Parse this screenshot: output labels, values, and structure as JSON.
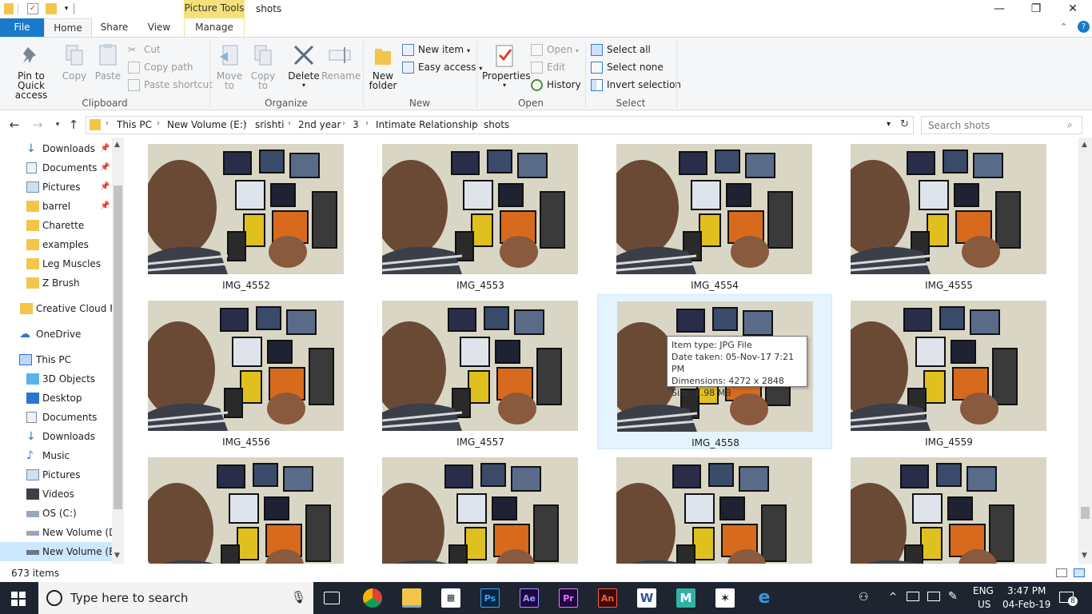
{
  "window": {
    "title": "shots",
    "context_tab": "Picture Tools",
    "controls": {
      "minimize": "—",
      "maximize": "❐",
      "close": "✕"
    }
  },
  "ribbon_tabs": {
    "file": "File",
    "home": "Home",
    "share": "Share",
    "view": "View",
    "manage": "Manage"
  },
  "ribbon": {
    "clipboard": {
      "label": "Clipboard",
      "pin": "Pin to Quick access",
      "pin_l1": "Pin to Quick",
      "pin_l2": "access",
      "copy": "Copy",
      "paste": "Paste",
      "cut": "Cut",
      "copy_path": "Copy path",
      "paste_shortcut": "Paste shortcut"
    },
    "organize": {
      "label": "Organize",
      "move_l1": "Move",
      "move_l2": "to",
      "copy_l1": "Copy",
      "copy_l2": "to",
      "delete": "Delete",
      "rename": "Rename"
    },
    "new": {
      "label": "New",
      "new_folder_l1": "New",
      "new_folder_l2": "folder",
      "new_item": "New item",
      "easy_access": "Easy access"
    },
    "open": {
      "label": "Open",
      "properties": "Properties",
      "open": "Open",
      "edit": "Edit",
      "history": "History"
    },
    "select": {
      "label": "Select",
      "select_all": "Select all",
      "select_none": "Select none",
      "invert": "Invert selection"
    }
  },
  "address": {
    "crumbs": [
      "This PC",
      "New Volume (E:)",
      "srishti",
      "2nd year",
      "3",
      "Intimate Relationship",
      "shots"
    ],
    "search_placeholder": "Search shots"
  },
  "nav": {
    "quick_access": [
      {
        "label": "Downloads",
        "pinned": true
      },
      {
        "label": "Documents",
        "pinned": true
      },
      {
        "label": "Pictures",
        "pinned": true
      },
      {
        "label": "barrel",
        "pinned": true
      },
      {
        "label": "Charette",
        "pinned": false
      },
      {
        "label": "examples",
        "pinned": false
      },
      {
        "label": "Leg Muscles",
        "pinned": false
      },
      {
        "label": "Z Brush",
        "pinned": false
      }
    ],
    "creative_cloud": "Creative Cloud Fil",
    "onedrive": "OneDrive",
    "this_pc": "This PC",
    "this_pc_items": [
      "3D Objects",
      "Desktop",
      "Documents",
      "Downloads",
      "Music",
      "Pictures",
      "Videos",
      "OS (C:)",
      "New Volume (D:",
      "New Volume (E:)"
    ]
  },
  "files": [
    {
      "name": "IMG_4552"
    },
    {
      "name": "IMG_4553"
    },
    {
      "name": "IMG_4554"
    },
    {
      "name": "IMG_4555"
    },
    {
      "name": "IMG_4556"
    },
    {
      "name": "IMG_4557"
    },
    {
      "name": "IMG_4558"
    },
    {
      "name": "IMG_4559"
    },
    {
      "name": ""
    },
    {
      "name": ""
    },
    {
      "name": ""
    },
    {
      "name": ""
    }
  ],
  "tooltip": {
    "type": "Item type: JPG File",
    "date": "Date taken: 05-Nov-17 7:21 PM",
    "dims": "Dimensions: 4272 x 2848",
    "size": "Size: 1.98 MB"
  },
  "status": {
    "count": "673 items"
  },
  "taskbar": {
    "search_placeholder": "Type here to search",
    "apps": [
      "Ps",
      "Ae",
      "Pr",
      "An",
      "W",
      "M"
    ],
    "lang_top": "ENG",
    "lang_bottom": "US",
    "time": "3:47 PM",
    "date": "04-Feb-19",
    "notifications": "8"
  },
  "colors": {
    "accent": "#1979ca",
    "selection": "#cce8ff",
    "taskbar": "#1e2530",
    "context_tab": "#f5e07a"
  }
}
